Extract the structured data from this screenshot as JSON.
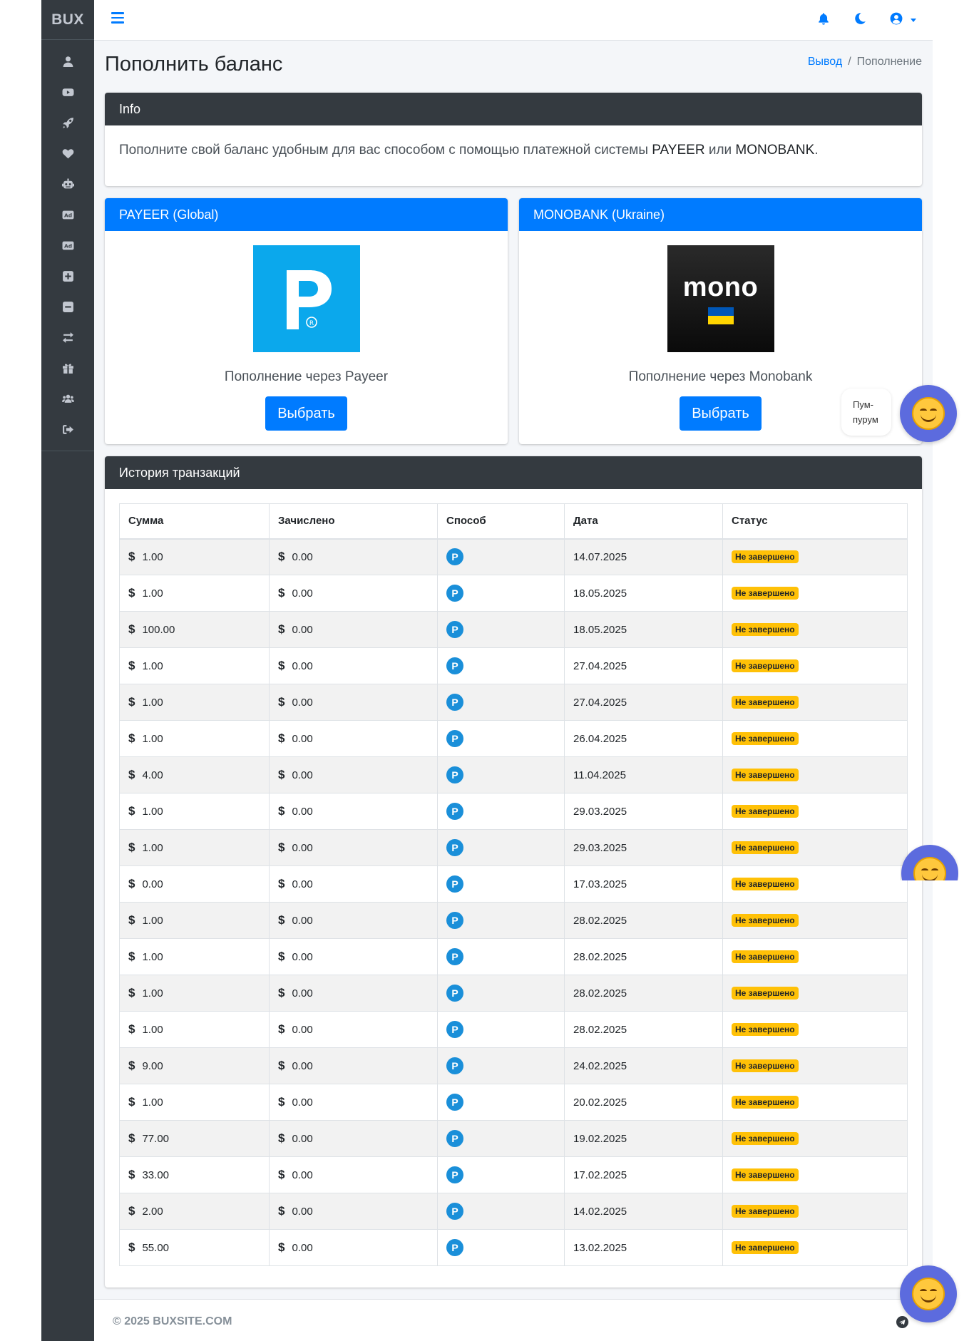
{
  "sidebar": {
    "brand": "BUX",
    "items": [
      {
        "icon": "user-icon"
      },
      {
        "icon": "youtube-icon"
      },
      {
        "icon": "rocket-icon"
      },
      {
        "icon": "heart-icon"
      },
      {
        "icon": "robot-icon"
      },
      {
        "icon": "ad-icon"
      },
      {
        "icon": "ad-icon"
      },
      {
        "icon": "plus-square-icon"
      },
      {
        "icon": "minus-square-icon"
      },
      {
        "icon": "exchange-icon"
      },
      {
        "icon": "gift-icon"
      },
      {
        "icon": "users-icon"
      },
      {
        "icon": "sign-out-icon"
      }
    ]
  },
  "page": {
    "title": "Пополнить баланс",
    "breadcrumb": {
      "link": "Вывод",
      "sep": "/",
      "current": "Пополнение"
    }
  },
  "info": {
    "header": "Info",
    "text_before": "Пополните свой баланс удобным для вас способом с помощью платежной системы ",
    "payeer": "PAYEER",
    "middle": " или ",
    "monobank": "MONOBANK",
    "end": "."
  },
  "methods": [
    {
      "header": "PAYEER (Global)",
      "label": "Пополнение через Payeer",
      "button": "Выбрать"
    },
    {
      "header": "MONOBANK (Ukraine)",
      "label": "Пополнение через Monobank",
      "button": "Выбрать",
      "logo_text": "mono"
    }
  ],
  "history": {
    "header": "История транзакций",
    "columns": [
      "Сумма",
      "Зачислено",
      "Способ",
      "Дата",
      "Статус"
    ],
    "currency_symbol": "$",
    "method_badge": "P",
    "rows": [
      {
        "amount": "1.00",
        "credited": "0.00",
        "date": "14.07.2025",
        "status": "Не завершено"
      },
      {
        "amount": "1.00",
        "credited": "0.00",
        "date": "18.05.2025",
        "status": "Не завершено"
      },
      {
        "amount": "100.00",
        "credited": "0.00",
        "date": "18.05.2025",
        "status": "Не завершено"
      },
      {
        "amount": "1.00",
        "credited": "0.00",
        "date": "27.04.2025",
        "status": "Не завершено"
      },
      {
        "amount": "1.00",
        "credited": "0.00",
        "date": "27.04.2025",
        "status": "Не завершено"
      },
      {
        "amount": "1.00",
        "credited": "0.00",
        "date": "26.04.2025",
        "status": "Не завершено"
      },
      {
        "amount": "4.00",
        "credited": "0.00",
        "date": "11.04.2025",
        "status": "Не завершено"
      },
      {
        "amount": "1.00",
        "credited": "0.00",
        "date": "29.03.2025",
        "status": "Не завершено"
      },
      {
        "amount": "1.00",
        "credited": "0.00",
        "date": "29.03.2025",
        "status": "Не завершено"
      },
      {
        "amount": "0.00",
        "credited": "0.00",
        "date": "17.03.2025",
        "status": "Не завершено"
      },
      {
        "amount": "1.00",
        "credited": "0.00",
        "date": "28.02.2025",
        "status": "Не завершено"
      },
      {
        "amount": "1.00",
        "credited": "0.00",
        "date": "28.02.2025",
        "status": "Не завершено"
      },
      {
        "amount": "1.00",
        "credited": "0.00",
        "date": "28.02.2025",
        "status": "Не завершено"
      },
      {
        "amount": "1.00",
        "credited": "0.00",
        "date": "28.02.2025",
        "status": "Не завершено"
      },
      {
        "amount": "9.00",
        "credited": "0.00",
        "date": "24.02.2025",
        "status": "Не завершено"
      },
      {
        "amount": "1.00",
        "credited": "0.00",
        "date": "20.02.2025",
        "status": "Не завершено"
      },
      {
        "amount": "77.00",
        "credited": "0.00",
        "date": "19.02.2025",
        "status": "Не завершено"
      },
      {
        "amount": "33.00",
        "credited": "0.00",
        "date": "17.02.2025",
        "status": "Не завершено"
      },
      {
        "amount": "2.00",
        "credited": "0.00",
        "date": "14.02.2025",
        "status": "Не завершено"
      },
      {
        "amount": "55.00",
        "credited": "0.00",
        "date": "13.02.2025",
        "status": "Не завершено"
      }
    ]
  },
  "footer": {
    "text": "© 2025 BUXSITE.COM"
  },
  "chat": {
    "bubble_line1": "Пум-",
    "bubble_line2": "пурум"
  },
  "colors": {
    "primary": "#007bff",
    "dark": "#343a40",
    "warning": "#ffc107",
    "payeer": "#0ba8ec"
  }
}
